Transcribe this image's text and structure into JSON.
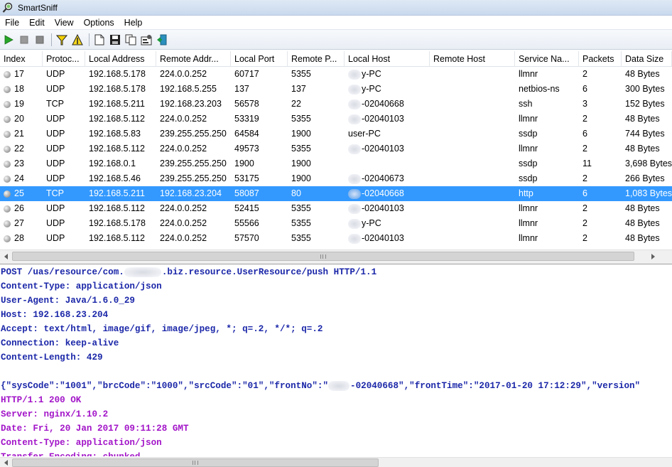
{
  "app": {
    "title": "SmartSniff"
  },
  "menu": [
    "File",
    "Edit",
    "View",
    "Options",
    "Help"
  ],
  "toolbar": {
    "buttons": [
      {
        "name": "start-capture-button",
        "icon": "play-icon"
      },
      {
        "name": "stop-capture-button",
        "icon": "stop-icon"
      },
      {
        "name": "pause-button",
        "icon": "square-icon"
      },
      {
        "name": "filter-button",
        "icon": "funnel-icon"
      },
      {
        "name": "display-filter-button",
        "icon": "yellow-triangle-icon"
      },
      {
        "name": "new-button",
        "icon": "document-icon"
      },
      {
        "name": "save-button",
        "icon": "floppy-icon"
      },
      {
        "name": "copy-button",
        "icon": "copy-icon"
      },
      {
        "name": "properties-button",
        "icon": "properties-icon"
      },
      {
        "name": "exit-button",
        "icon": "exit-icon"
      }
    ]
  },
  "columns": [
    "Index",
    "Protoc...",
    "Local Address",
    "Remote Addr...",
    "Local Port",
    "Remote P...",
    "Local Host",
    "Remote Host",
    "Service Na...",
    "Packets",
    "Data Size"
  ],
  "rows": [
    {
      "index": "17",
      "protocol": "UDP",
      "local_address": "192.168.5.178",
      "remote_address": "224.0.0.252",
      "local_port": "60717",
      "remote_port": "5355",
      "local_host": "y-PC",
      "remote_host": "",
      "service": "llmnr",
      "packets": "2",
      "data_size": "48 Bytes"
    },
    {
      "index": "18",
      "protocol": "UDP",
      "local_address": "192.168.5.178",
      "remote_address": "192.168.5.255",
      "local_port": "137",
      "remote_port": "137",
      "local_host": "y-PC",
      "remote_host": "",
      "service": "netbios-ns",
      "packets": "6",
      "data_size": "300 Bytes"
    },
    {
      "index": "19",
      "protocol": "TCP",
      "local_address": "192.168.5.211",
      "remote_address": "192.168.23.203",
      "local_port": "56578",
      "remote_port": "22",
      "local_host": "-02040668",
      "remote_host": "",
      "service": "ssh",
      "packets": "3",
      "data_size": "152 Bytes"
    },
    {
      "index": "20",
      "protocol": "UDP",
      "local_address": "192.168.5.112",
      "remote_address": "224.0.0.252",
      "local_port": "53319",
      "remote_port": "5355",
      "local_host": "-02040103",
      "remote_host": "",
      "service": "llmnr",
      "packets": "2",
      "data_size": "48 Bytes"
    },
    {
      "index": "21",
      "protocol": "UDP",
      "local_address": "192.168.5.83",
      "remote_address": "239.255.255.250",
      "local_port": "64584",
      "remote_port": "1900",
      "local_host": "user-PC",
      "remote_host": "",
      "service": "ssdp",
      "packets": "6",
      "data_size": "744 Bytes"
    },
    {
      "index": "22",
      "protocol": "UDP",
      "local_address": "192.168.5.112",
      "remote_address": "224.0.0.252",
      "local_port": "49573",
      "remote_port": "5355",
      "local_host": "-02040103",
      "remote_host": "",
      "service": "llmnr",
      "packets": "2",
      "data_size": "48 Bytes"
    },
    {
      "index": "23",
      "protocol": "UDP",
      "local_address": "192.168.0.1",
      "remote_address": "239.255.255.250",
      "local_port": "1900",
      "remote_port": "1900",
      "local_host": "",
      "remote_host": "",
      "service": "ssdp",
      "packets": "11",
      "data_size": "3,698 Bytes"
    },
    {
      "index": "24",
      "protocol": "UDP",
      "local_address": "192.168.5.46",
      "remote_address": "239.255.255.250",
      "local_port": "53175",
      "remote_port": "1900",
      "local_host": "-02040673",
      "remote_host": "",
      "service": "ssdp",
      "packets": "2",
      "data_size": "266 Bytes"
    },
    {
      "index": "25",
      "protocol": "TCP",
      "local_address": "192.168.5.211",
      "remote_address": "192.168.23.204",
      "local_port": "58087",
      "remote_port": "80",
      "local_host": "-02040668",
      "remote_host": "",
      "service": "http",
      "packets": "6",
      "data_size": "1,083 Bytes",
      "selected": true
    },
    {
      "index": "26",
      "protocol": "UDP",
      "local_address": "192.168.5.112",
      "remote_address": "224.0.0.252",
      "local_port": "52415",
      "remote_port": "5355",
      "local_host": "-02040103",
      "remote_host": "",
      "service": "llmnr",
      "packets": "2",
      "data_size": "48 Bytes"
    },
    {
      "index": "27",
      "protocol": "UDP",
      "local_address": "192.168.5.178",
      "remote_address": "224.0.0.252",
      "local_port": "55566",
      "remote_port": "5355",
      "local_host": "y-PC",
      "remote_host": "",
      "service": "llmnr",
      "packets": "2",
      "data_size": "48 Bytes"
    },
    {
      "index": "28",
      "protocol": "UDP",
      "local_address": "192.168.5.112",
      "remote_address": "224.0.0.252",
      "local_port": "57570",
      "remote_port": "5355",
      "local_host": "-02040103",
      "remote_host": "",
      "service": "llmnr",
      "packets": "2",
      "data_size": "48 Bytes"
    }
  ],
  "content": {
    "lines": [
      {
        "kind": "req",
        "text": "POST /uas/resource/com.",
        "blur_after": true,
        "rest": ".biz.resource.UserResource/push HTTP/1.1"
      },
      {
        "kind": "req",
        "text": "Content-Type: application/json"
      },
      {
        "kind": "req",
        "text": "User-Agent: Java/1.6.0_29"
      },
      {
        "kind": "req",
        "text": "Host: 192.168.23.204"
      },
      {
        "kind": "req",
        "text": "Accept: text/html, image/gif, image/jpeg, *; q=.2, */*; q=.2"
      },
      {
        "kind": "req",
        "text": "Connection: keep-alive"
      },
      {
        "kind": "req",
        "text": "Content-Length: 429"
      },
      {
        "kind": "req",
        "text": ""
      },
      {
        "kind": "req",
        "text": "{\"sysCode\":\"1001\",\"brcCode\":\"1000\",\"srcCode\":\"01\",\"frontNo\":\"",
        "blur_after": true,
        "rest": "-02040668\",\"frontTime\":\"2017-01-20 17:12:29\",\"version\""
      },
      {
        "kind": "resp",
        "text": "HTTP/1.1 200 OK"
      },
      {
        "kind": "resp",
        "text": "Server: nginx/1.10.2"
      },
      {
        "kind": "resp",
        "text": "Date: Fri, 20 Jan 2017 09:11:28 GMT"
      },
      {
        "kind": "resp",
        "text": "Content-Type: application/json"
      },
      {
        "kind": "resp",
        "text": "Transfer-Encoding: chunked"
      }
    ]
  },
  "colors": {
    "selection": "#3399ff",
    "request_text": "#1b27a8",
    "response_text": "#a214c8"
  }
}
